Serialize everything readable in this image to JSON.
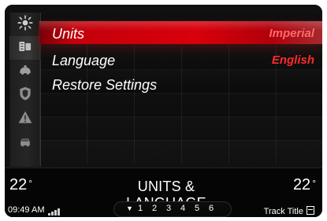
{
  "menu": {
    "items": [
      {
        "label": "Units",
        "value": "Imperial"
      },
      {
        "label": "Language",
        "value": "English"
      },
      {
        "label": "Restore Settings",
        "value": ""
      }
    ]
  },
  "sidebar": {
    "items": [
      {
        "icon": "sun-icon"
      },
      {
        "icon": "display-settings-icon"
      },
      {
        "icon": "vehicle-settings-icon"
      },
      {
        "icon": "shield-icon"
      },
      {
        "icon": "warning-icon"
      },
      {
        "icon": "car-icon"
      }
    ]
  },
  "footer": {
    "temp_left": "22",
    "temp_right": "22",
    "temp_unit": "°",
    "title": "UNITS & LANGUAGE",
    "time": "09:49 AM",
    "presets": [
      "1",
      "2",
      "3",
      "4",
      "5",
      "6"
    ],
    "track_title": "Track Title"
  },
  "colors": {
    "accent_red": "#d8000b",
    "highlight_text": "#ff6a6a",
    "value_red": "#ff2a2a"
  }
}
